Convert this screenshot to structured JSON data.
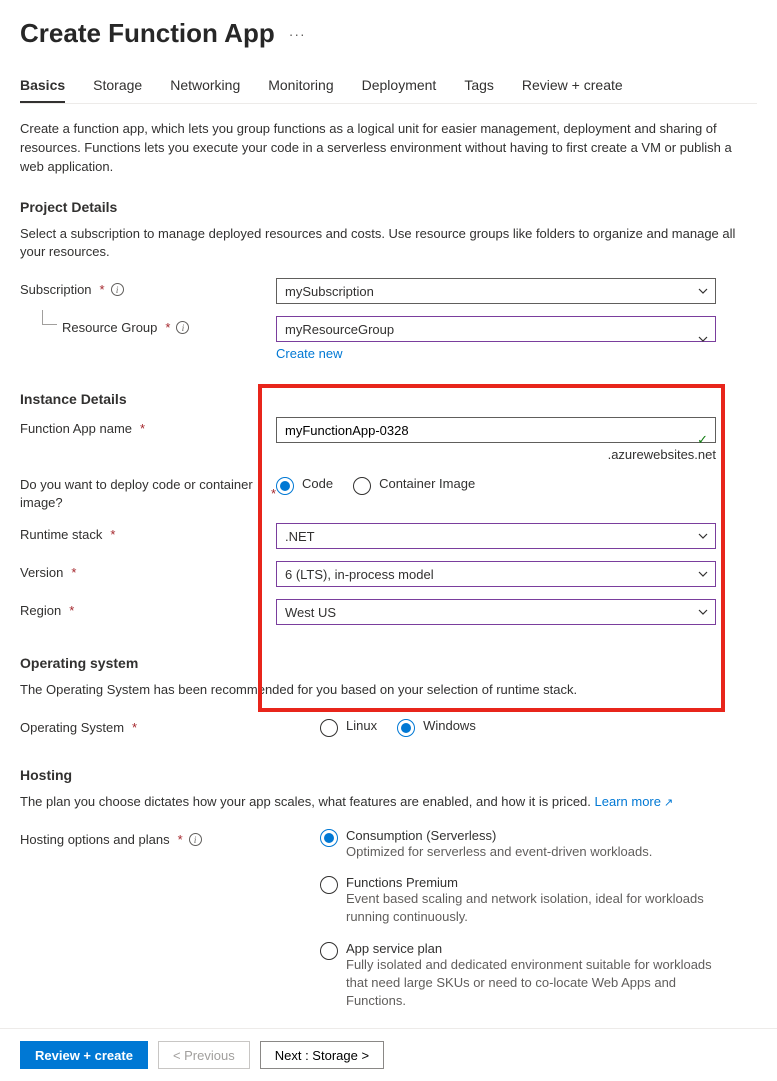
{
  "title": "Create Function App",
  "tabs": [
    "Basics",
    "Storage",
    "Networking",
    "Monitoring",
    "Deployment",
    "Tags",
    "Review + create"
  ],
  "activeTab": "Basics",
  "intro": "Create a function app, which lets you group functions as a logical unit for easier management, deployment and sharing of resources. Functions lets you execute your code in a serverless environment without having to first create a VM or publish a web application.",
  "projectDetails": {
    "heading": "Project Details",
    "desc": "Select a subscription to manage deployed resources and costs. Use resource groups like folders to organize and manage all your resources.",
    "subscriptionLabel": "Subscription",
    "subscriptionValue": "mySubscription",
    "resourceGroupLabel": "Resource Group",
    "resourceGroupValue": "myResourceGroup",
    "createNew": "Create new"
  },
  "instanceDetails": {
    "heading": "Instance Details",
    "nameLabel": "Function App name",
    "nameValue": "myFunctionApp-0328",
    "domainSuffix": ".azurewebsites.net",
    "deployLabel": "Do you want to deploy code or container image?",
    "deployOptions": {
      "code": "Code",
      "container": "Container Image"
    },
    "runtimeLabel": "Runtime stack",
    "runtimeValue": ".NET",
    "versionLabel": "Version",
    "versionValue": "6 (LTS), in-process model",
    "regionLabel": "Region",
    "regionValue": "West US"
  },
  "os": {
    "heading": "Operating system",
    "desc": "The Operating System has been recommended for you based on your selection of runtime stack.",
    "label": "Operating System",
    "linux": "Linux",
    "windows": "Windows"
  },
  "hosting": {
    "heading": "Hosting",
    "desc": "The plan you choose dictates how your app scales, what features are enabled, and how it is priced. ",
    "learnMore": "Learn more",
    "label": "Hosting options and plans",
    "options": [
      {
        "title": "Consumption (Serverless)",
        "sub": "Optimized for serverless and event-driven workloads."
      },
      {
        "title": "Functions Premium",
        "sub": "Event based scaling and network isolation, ideal for workloads running continuously."
      },
      {
        "title": "App service plan",
        "sub": "Fully isolated and dedicated environment suitable for workloads that need large SKUs or need to co-locate Web Apps and Functions."
      }
    ]
  },
  "footer": {
    "reviewCreate": "Review + create",
    "previous": "< Previous",
    "next": "Next : Storage >"
  }
}
